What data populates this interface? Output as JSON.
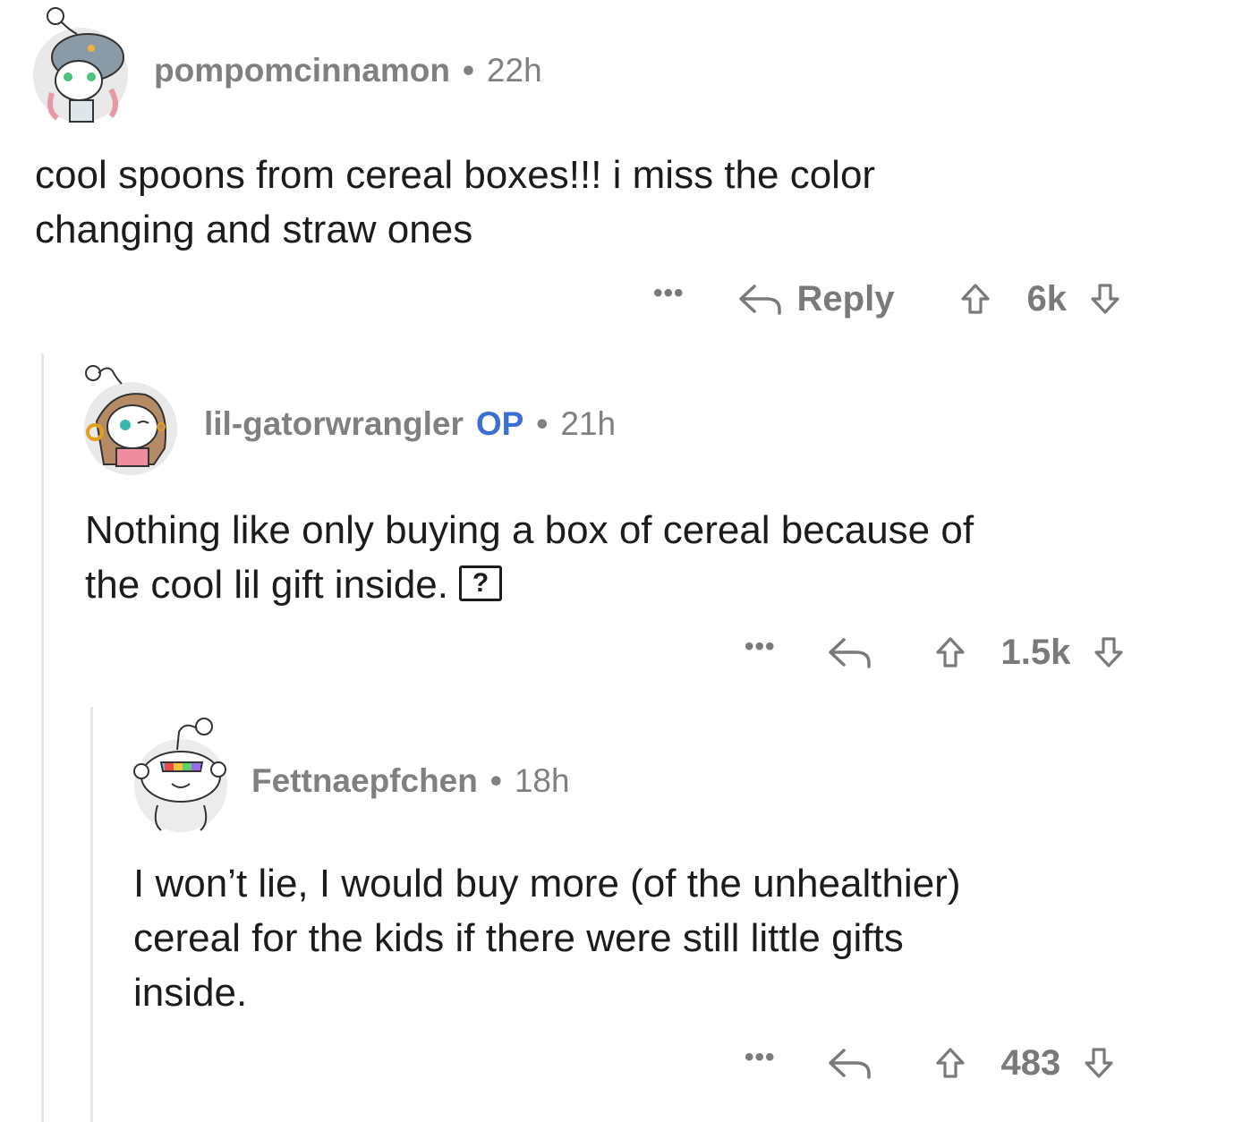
{
  "comments": [
    {
      "username": "pompomcinnamon",
      "time": "22h",
      "lines": [
        "cool spoons from cereal boxes!!! i miss the color",
        "changing and straw ones"
      ],
      "more": "•••",
      "reply_label": "Reply",
      "score": "6k"
    },
    {
      "username": "lil-gatorwrangler",
      "badge": "OP",
      "time": "21h",
      "lines": [
        "Nothing like only buying a box of cereal because of",
        "the cool lil gift inside."
      ],
      "inline_icon": "?",
      "more": "•••",
      "score": "1.5k"
    },
    {
      "username": "Fettnaepfchen",
      "time": "18h",
      "lines": [
        "I won’t lie, I would buy more (of the unhealthier)",
        "cereal for the kids if there were still little gifts",
        "inside."
      ],
      "more": "•••",
      "score": "483"
    }
  ],
  "separator": "•",
  "icons": {
    "reply": "reply-arrow-icon",
    "upvote": "upvote-arrow-icon",
    "downvote": "downvote-arrow-icon",
    "more": "more-options-icon",
    "help": "question-box-icon"
  },
  "colors": {
    "op_badge": "#3b6fd1",
    "meta_text": "#808080",
    "thread_line": "#e6e6e6"
  }
}
